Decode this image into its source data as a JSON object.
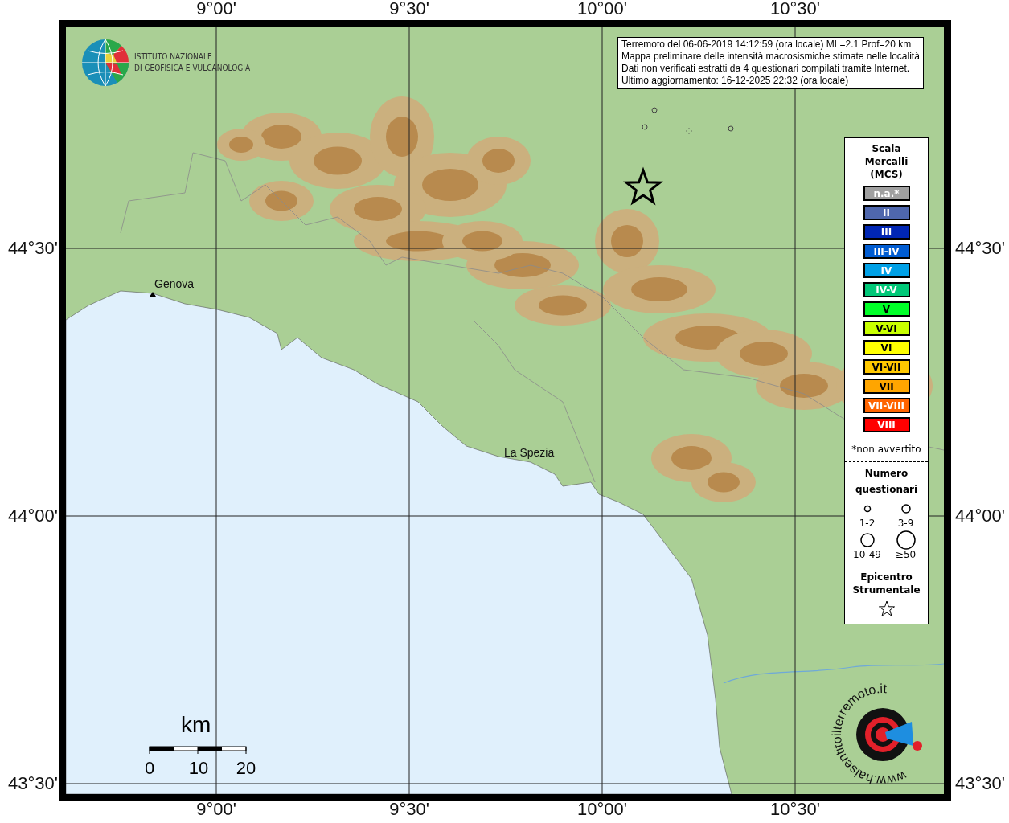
{
  "top_axis_labels": [
    "9°00'",
    "9°30'",
    "10°00'",
    "10°30'"
  ],
  "left_axis_labels": [
    "44°30'",
    "44°00'",
    "43°30'"
  ],
  "right_axis_labels": [
    "44°30'",
    "44°00'",
    "43°30'"
  ],
  "bottom_axis_labels": [
    "9°00'",
    "9°30'",
    "10°00'",
    "10°30'"
  ],
  "logo": {
    "lines": [
      "ISTITUTO NAZIONALE",
      "DI GEOFISICA E VULCANOLOGIA"
    ]
  },
  "info_box": {
    "lines": [
      "Terremoto del 06-06-2019 14:12:59 (ora locale) ML=2.1 Prof=20 km",
      "Mappa preliminare delle intensità macrosismiche stimate nelle località",
      "Dati non verificati estratti da 4 questionari compilati tramite Internet.",
      "Ultimo aggiornamento: 16-12-2025 22:32 (ora locale)"
    ]
  },
  "place_labels": [
    "Genova",
    "La Spezia"
  ],
  "legend": {
    "title_lines": [
      "Scala",
      "Mercalli",
      "(MCS)"
    ],
    "intensities": [
      {
        "label": "n.a.*",
        "color": "#a0a0a0"
      },
      {
        "label": "II",
        "color": "#4f67ad"
      },
      {
        "label": "III",
        "color": "#0026b4"
      },
      {
        "label": "III-IV",
        "color": "#005cd2"
      },
      {
        "label": "IV",
        "color": "#00a0e6"
      },
      {
        "label": "IV-V",
        "color": "#00c878"
      },
      {
        "label": "V",
        "color": "#00ff28"
      },
      {
        "label": "V-VI",
        "color": "#c8ff00"
      },
      {
        "label": "VI",
        "color": "#ffff00"
      },
      {
        "label": "VI-VII",
        "color": "#ffc800"
      },
      {
        "label": "VII",
        "color": "#ffa500"
      },
      {
        "label": "VII-VIII",
        "color": "#ff6400"
      },
      {
        "label": "VIII",
        "color": "#ff0000"
      }
    ],
    "footnote": "*non avvertito",
    "questionnaire_title_lines": [
      "Numero",
      "questionari"
    ],
    "sizes": [
      {
        "label": "1-2",
        "kind": "tiny"
      },
      {
        "label": "3-9",
        "kind": "small"
      },
      {
        "label": "10-49",
        "kind": "medium"
      },
      {
        "label": "≥50",
        "kind": "large"
      }
    ],
    "epicenter_title_lines": [
      "Epicentro",
      "Strumentale"
    ]
  },
  "scale_bar": {
    "unit": "km",
    "ticks": [
      "0",
      "10",
      "20"
    ]
  },
  "badge": {
    "text": "www.haisentitoilterremoto.it"
  }
}
